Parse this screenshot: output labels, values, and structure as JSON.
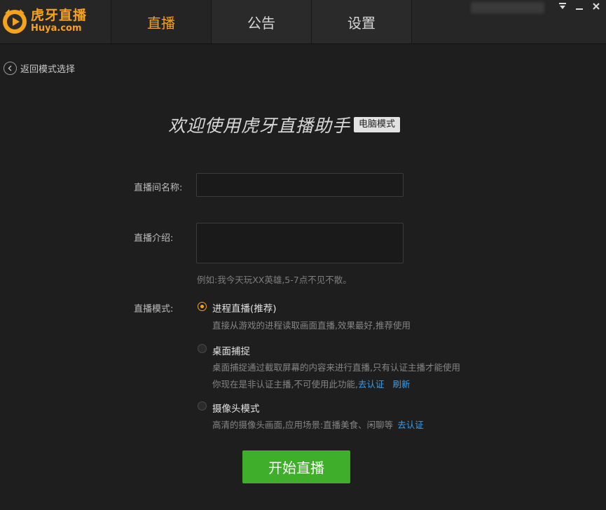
{
  "app": {
    "logo_cn": "虎牙直播",
    "logo_en": "Huya.com"
  },
  "tabs": [
    {
      "label": "直播",
      "active": true
    },
    {
      "label": "公告",
      "active": false
    },
    {
      "label": "设置",
      "active": false
    }
  ],
  "window_controls": [
    "dropdown-icon",
    "minimize-icon",
    "close-icon"
  ],
  "back": {
    "label": "返回模式选择",
    "icon": "back-arrow-icon"
  },
  "welcome": {
    "title": "欢迎使用虎牙直播助手",
    "badge": "电脑模式"
  },
  "form": {
    "name_label": "直播间名称:",
    "name_value": "",
    "intro_label": "直播介绍:",
    "intro_value": "",
    "hint": "例如:我今天玩XX英雄,5-7点不见不散。",
    "mode_label": "直播模式:",
    "modes": [
      {
        "title": "进程直播(推荐)",
        "checked": true,
        "desc": "直接从游戏的进程读取画面直播,效果最好,推荐使用"
      },
      {
        "title": "桌面捕捉",
        "checked": false,
        "desc": "桌面捕捉通过截取屏幕的内容来进行直播,只有认证主播才能使用",
        "desc2": "你现在是非认证主播,不可使用此功能,",
        "link1": "去认证",
        "link2": "刷新"
      },
      {
        "title": "摄像头模式",
        "checked": false,
        "desc": "高清的摄像头画面,应用场景:直播美食、闲聊等",
        "link1": "去认证"
      }
    ]
  },
  "start_button": "开始直播",
  "colors": {
    "accent": "#f7a21b",
    "start_button": "#3fae2a",
    "link": "#3a9ff0",
    "background": "#1e1e1e"
  }
}
